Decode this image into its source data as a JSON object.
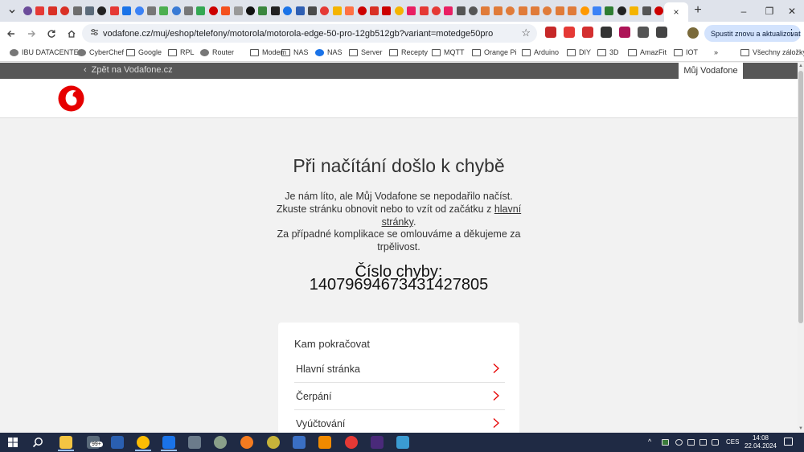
{
  "browser": {
    "tab_favicon_colors": [
      "#6b4c9a",
      "#e53935",
      "#d93025",
      "#d93025",
      "#6d6d6d",
      "#5b6b7a",
      "#222222",
      "#e53935",
      "#1a73e8",
      "#3b82f6",
      "#777777",
      "#4caf50",
      "#3a7bd5",
      "#777777",
      "#34a853",
      "#cc0000",
      "#f4511e",
      "#999999",
      "#111111",
      "#3b873e",
      "#222222",
      "#1a73e8",
      "#2f5fb3",
      "#4b4b4b",
      "#e53935",
      "#f4b400",
      "#ff7043",
      "#cc0000",
      "#d93025",
      "#cc0000",
      "#f4b400",
      "#e91e63",
      "#e53935",
      "#e53935",
      "#e91e63",
      "#555555",
      "#555555",
      "#e07b39",
      "#e07b39",
      "#e07b39",
      "#e07b39",
      "#e07b39",
      "#e07b39",
      "#e07b39",
      "#e07b39",
      "#ff9900",
      "#3b82f6",
      "#2e7d32",
      "#222222",
      "#f4b400",
      "#555555",
      "#cc0000",
      "#e53935"
    ],
    "active_tab_close": "×",
    "new_tab": "+",
    "window_controls": [
      "–",
      "❐",
      "✕"
    ],
    "url": "vodafone.cz/muj/eshop/telefony/motorola/motorola-edge-50-pro-12gb512gb?variant=motedge50pro",
    "update_button": "Spustit znovu a aktualizovat",
    "extension_colors": [
      "#c62828",
      "#e53935",
      "#d32f2f",
      "#333333",
      "#ad1457",
      "#555555",
      "#444444"
    ],
    "bookmarks": [
      {
        "label": "IBU DATACENTER",
        "icon": "link-icon"
      },
      {
        "label": "CyberChef",
        "icon": "chef-icon"
      },
      {
        "label": "Google",
        "icon": "folder-icon"
      },
      {
        "label": "RPL",
        "icon": "folder-icon"
      },
      {
        "label": "Router",
        "icon": "router-icon"
      },
      {
        "label": "Modem",
        "icon": "folder-icon"
      },
      {
        "label": "NAS",
        "icon": "folder-icon"
      },
      {
        "label": "NAS",
        "icon": "dsm-icon"
      },
      {
        "label": "Server",
        "icon": "folder-icon"
      },
      {
        "label": "Recepty",
        "icon": "folder-icon"
      },
      {
        "label": "MQTT",
        "icon": "folder-icon"
      },
      {
        "label": "Orange Pi",
        "icon": "folder-icon"
      },
      {
        "label": "Arduino",
        "icon": "folder-icon"
      },
      {
        "label": "DIY",
        "icon": "folder-icon"
      },
      {
        "label": "3D",
        "icon": "folder-icon"
      },
      {
        "label": "AmazFit",
        "icon": "folder-icon"
      },
      {
        "label": "IOT",
        "icon": "folder-icon"
      }
    ],
    "bookmarks_more": "»",
    "all_bookmarks": "Všechny záložky"
  },
  "page": {
    "back_link": "Zpět na Vodafone.cz",
    "my_vodafone": "Můj Vodafone",
    "error_title": "Při načítání došlo k chybě",
    "error_text_before": "Je nám líto, ale Můj Vodafone se nepodařilo načíst. Zkuste stránku obnovit nebo to vzít od začátku z ",
    "error_link": "hlavní stránky",
    "error_text_after": ".",
    "apology_text": "Za případné komplikace se omlouváme a děkujeme za trpělivost.",
    "error_number_label": "Číslo chyby:",
    "error_number": "14079694673431427805",
    "card": {
      "title": "Kam pokračovat",
      "items": [
        "Hlavní stránka",
        "Čerpání",
        "Vyúčtování"
      ]
    },
    "brand_color": "#e60000"
  },
  "taskbar": {
    "badge": "99+",
    "language": "CES",
    "time": "14:08",
    "date": "22.04.2024"
  }
}
